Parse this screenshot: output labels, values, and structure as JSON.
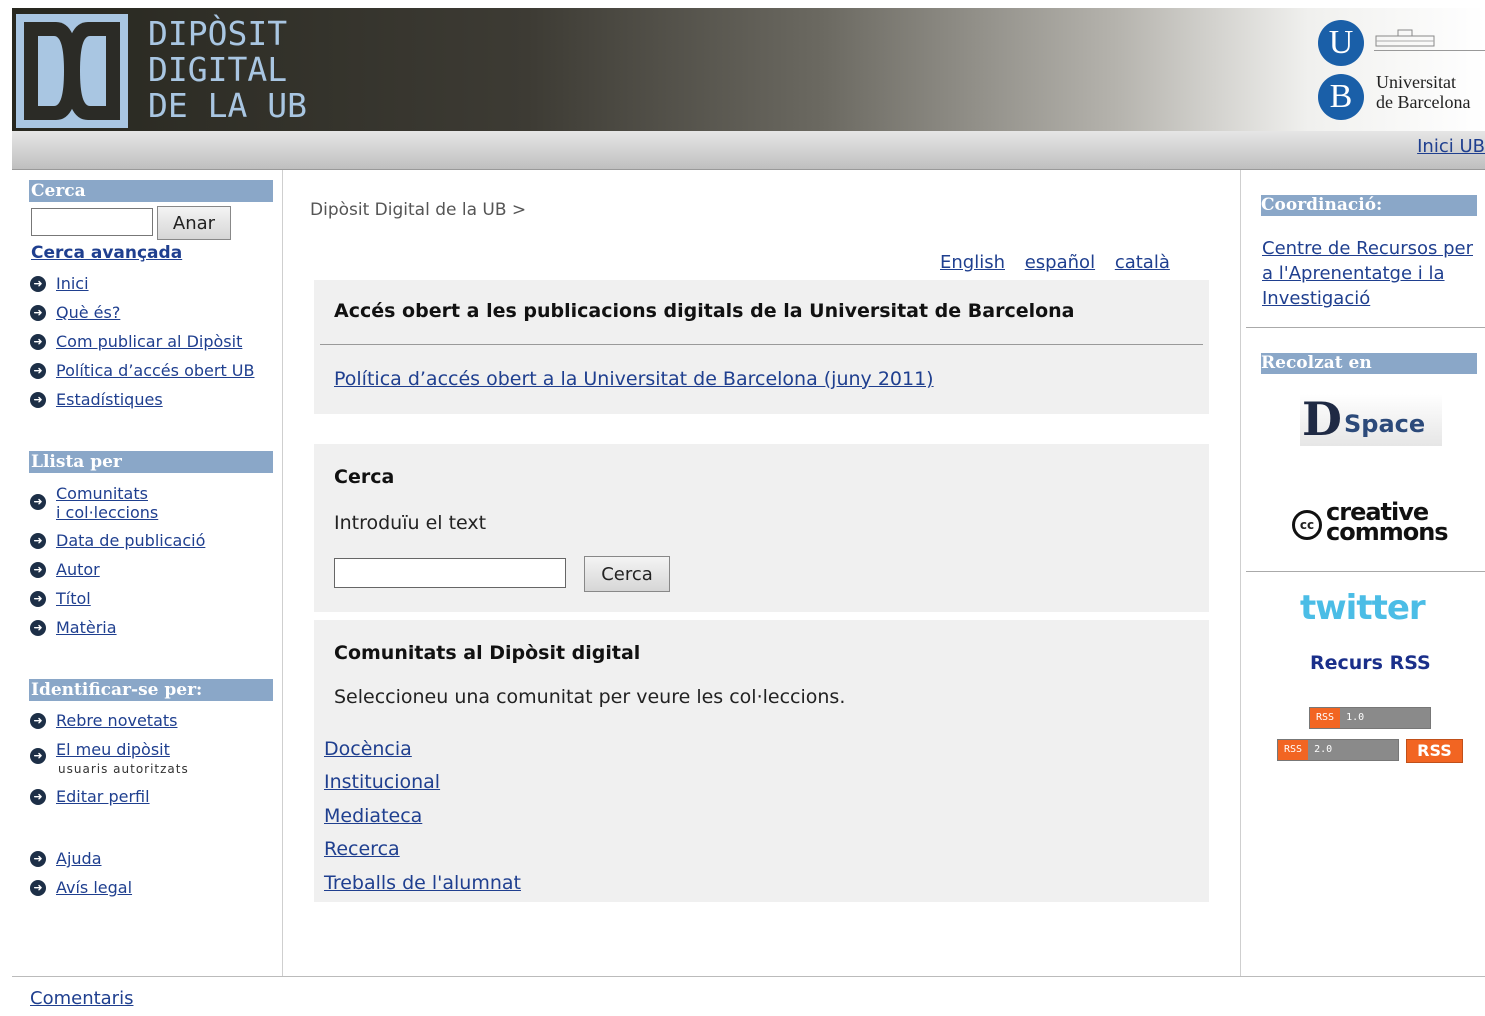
{
  "header": {
    "logo_lines": [
      "DIPÒSIT",
      "DIGITAL",
      "DE LA UB"
    ],
    "ub_letters": [
      "U",
      "B"
    ],
    "ub_name_lines": [
      "Universitat",
      "de Barcelona"
    ],
    "inici_ub": "Inici UB"
  },
  "left": {
    "search_heading": "Cerca",
    "search_button": "Anar",
    "advanced_search": "Cerca avançada",
    "nav": [
      "Inici",
      "Què és?",
      "Com publicar al Dipòsit",
      "Política d’accés obert UB",
      "Estadístiques"
    ],
    "browse_heading": "Llista per",
    "browse_line1": "Comunitats",
    "browse_line2": "i col·leccions",
    "browse": [
      "Data de publicació",
      "Autor",
      "Títol",
      "Matèria"
    ],
    "identify_heading": "Identificar-se per:",
    "novetats": "Rebre novetats",
    "meu_diposit": "El meu dipòsit",
    "usuaris": "usuaris autoritzats",
    "editar_perfil": "Editar perfil",
    "ajuda": "Ajuda",
    "avis_legal": "Avís legal"
  },
  "main": {
    "breadcrumb": "Dipòsit Digital de la UB >",
    "languages": [
      "English",
      "español",
      "català"
    ],
    "intro_title": "Accés obert a les publicacions digitals de la Universitat de Barcelona",
    "policy_link": "Política d’accés obert a la Universitat de Barcelona (juny 2011)",
    "search_title": "Cerca",
    "search_label": "Introduïu el text",
    "search_button": "Cerca",
    "communities_title": "Comunitats al Dipòsit digital",
    "communities_desc": "Seleccioneu una comunitat per veure les col·leccions.",
    "communities": [
      "Docència",
      "Institucional",
      "Mediateca",
      "Recerca",
      "Treballs de l'alumnat"
    ]
  },
  "right": {
    "coord_heading": "Coordinació:",
    "coord_link": "Centre de Recursos per a l'Aprenentatge i la Investigació",
    "harvested_heading": "Recolzat en",
    "dspace": "Space",
    "dspace_d": "D",
    "cc_line1": "creative",
    "cc_line2": "commons",
    "twitter": "twitter",
    "rss_title": "Recurs RSS",
    "rss1": [
      "RSS",
      "1.0"
    ],
    "rss2": [
      "RSS",
      "2.0"
    ],
    "rss_big": "RSS"
  },
  "footer": {
    "comentaris": "Comentaris"
  },
  "colors": {
    "header_blue": "#a9c6e2",
    "sidebar_heading": "#8aa7c8",
    "link": "#1f3f8f",
    "rss_orange": "#f26522"
  }
}
